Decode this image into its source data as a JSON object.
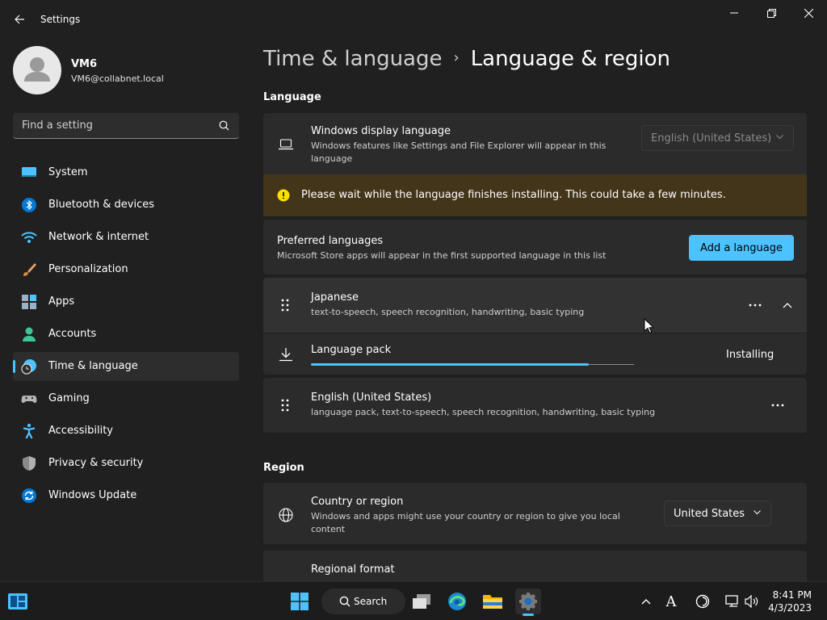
{
  "window": {
    "title": "Settings"
  },
  "user": {
    "name": "VM6",
    "email": "VM6@collabnet.local"
  },
  "search": {
    "placeholder": "Find a setting"
  },
  "nav": [
    {
      "label": "System",
      "icon": "monitor-icon"
    },
    {
      "label": "Bluetooth & devices",
      "icon": "bluetooth-icon"
    },
    {
      "label": "Network & internet",
      "icon": "wifi-icon"
    },
    {
      "label": "Personalization",
      "icon": "brush-icon"
    },
    {
      "label": "Apps",
      "icon": "apps-icon"
    },
    {
      "label": "Accounts",
      "icon": "person-icon"
    },
    {
      "label": "Time & language",
      "icon": "clock-globe-icon",
      "selected": true
    },
    {
      "label": "Gaming",
      "icon": "controller-icon"
    },
    {
      "label": "Accessibility",
      "icon": "accessibility-icon"
    },
    {
      "label": "Privacy & security",
      "icon": "shield-icon"
    },
    {
      "label": "Windows Update",
      "icon": "update-icon"
    }
  ],
  "breadcrumb": {
    "parent": "Time & language",
    "current": "Language & region"
  },
  "language": {
    "heading": "Language",
    "display": {
      "title": "Windows display language",
      "desc1": "Windows features like Settings and File Explorer will appear in this",
      "desc2": "language",
      "value": "English (United States)"
    },
    "warning": "Please wait while the language finishes installing. This could take a few minutes.",
    "preferred": {
      "title": "Preferred languages",
      "desc": "Microsoft Store apps will appear in the first supported language in this list",
      "add_button": "Add a language"
    },
    "items": [
      {
        "name": "Japanese",
        "features": "text-to-speech, speech recognition, handwriting, basic typing"
      },
      {
        "name": "English (United States)",
        "features": "language pack, text-to-speech, speech recognition, handwriting, basic typing"
      }
    ],
    "pack": {
      "label": "Language pack",
      "status": "Installing",
      "progress": 0.86
    }
  },
  "region": {
    "heading": "Region",
    "country": {
      "title": "Country or region",
      "desc1": "Windows and apps might use your country or region to give you local",
      "desc2": "content",
      "value": "United States"
    },
    "format": {
      "title": "Regional format"
    }
  },
  "taskbar": {
    "search_label": "Search",
    "time": "8:41 PM",
    "date": "4/3/2023"
  },
  "colors": {
    "accent": "#4cc2ff",
    "warning_bg": "#433519",
    "warning_icon": "#fce100"
  }
}
